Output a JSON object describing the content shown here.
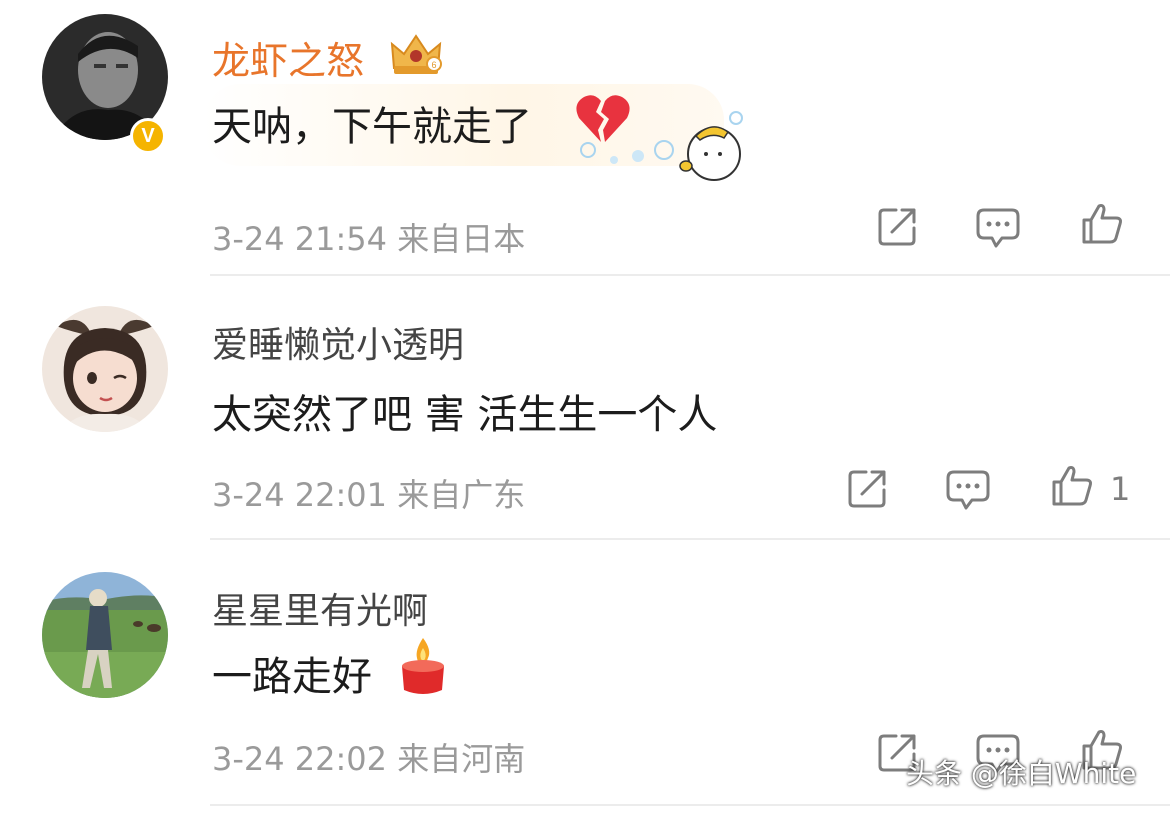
{
  "comments": [
    {
      "username": "龙虾之怒",
      "text": "天呐，下午就走了",
      "meta": "3-24 21:54 来自日本",
      "likes": "",
      "verified_label": "V"
    },
    {
      "username": "爱睡懒觉小透明",
      "text": "太突然了吧 害 活生生一个人",
      "meta": "3-24 22:01 来自广东",
      "likes": "1"
    },
    {
      "username": "星星里有光啊",
      "text": "一路走好",
      "meta": "3-24 22:02 来自河南",
      "likes": ""
    }
  ],
  "watermark": "头条 @徐白White",
  "icons": {
    "share": "share-icon",
    "comment": "comment-icon",
    "like": "thumbs-up-icon",
    "badge": "crown-badge-icon",
    "broken_heart": "broken-heart-emoji",
    "candle": "candle-emoji"
  },
  "colors": {
    "vip_name": "#e8752b",
    "name": "#444444",
    "text": "#1c1c1c",
    "meta": "#9a9a9a",
    "verified": "#f5b400"
  }
}
